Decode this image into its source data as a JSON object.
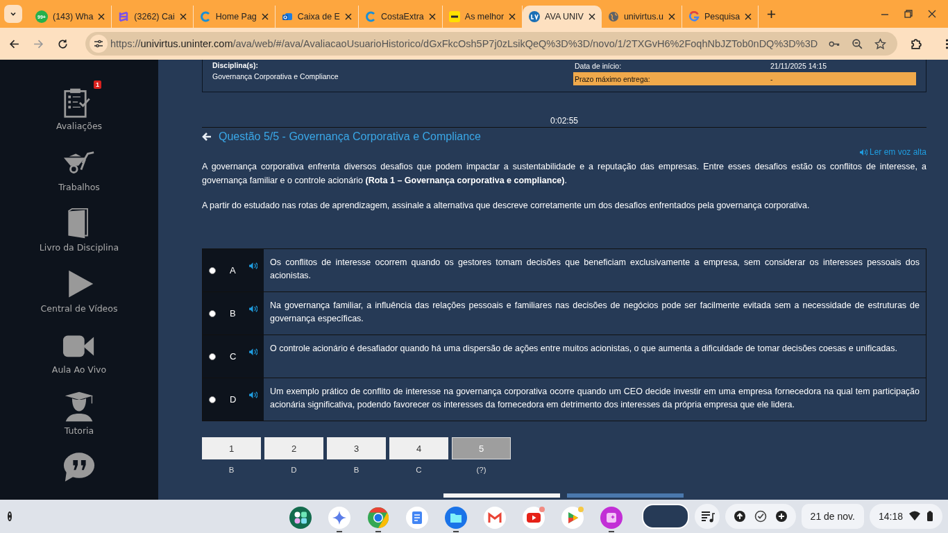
{
  "browser": {
    "tabs": [
      {
        "title": "(143) Wha",
        "badge": "99+",
        "selected": false
      },
      {
        "title": "(3262) Cai",
        "selected": false
      },
      {
        "title": "Home Pag",
        "selected": false
      },
      {
        "title": "Caixa de E",
        "selected": false
      },
      {
        "title": "CostaExtra",
        "selected": false
      },
      {
        "title": "As melhor",
        "selected": false
      },
      {
        "title": "AVA UNIV",
        "selected": true
      },
      {
        "title": "univirtus.u",
        "selected": false
      },
      {
        "title": "Pesquisa",
        "selected": false
      }
    ],
    "url_scheme": "https://",
    "url_host": "univirtus.uninter.com",
    "url_path": "/ava/web/#/ava/AvaliacaoUsuarioHistorico/dGxFkcOsh5P7j0zLsikQeQ%3D%3D/novo/1/2TXGvH6%2FoqhNbJZTob0nDQ%3D%3D"
  },
  "sidebar": {
    "items": [
      {
        "label": "Avaliações",
        "badge": "1"
      },
      {
        "label": "Trabalhos"
      },
      {
        "label": "Livro da Disciplina"
      },
      {
        "label": "Central de Vídeos"
      },
      {
        "label": "Aula Ao Vivo"
      },
      {
        "label": "Tutoria"
      }
    ]
  },
  "info": {
    "discipline_label": "Disciplina(s):",
    "discipline": "Governança Corporativa e Compliance",
    "start_label": "Data de início:",
    "start_value": "21/11/2025 14:15",
    "deadline_label": "Prazo máximo entrega:",
    "deadline_value": "-"
  },
  "timer": "0:02:55",
  "question": {
    "title": "Questão 5/5 - Governança Corporativa e Compliance",
    "read_aloud": "Ler em voz alta",
    "paragraphs": [
      "A governança corporativa enfrenta diversos desafios que podem impactar a sustentabilidade e a reputação das empresas. Entre esses desafios estão os conflitos de interesse, a governança familiar e o controle acionário **(Rota 1 – Governança corporativa e compliance)**.",
      "A partir do estudado nas rotas de aprendizagem, assinale a alternativa que descreve corretamente um dos desafios enfrentados pela governança corporativa."
    ],
    "options": [
      {
        "letter": "A",
        "text": "Os conflitos de interesse ocorrem quando os gestores tomam decisões que beneficiam exclusivamente a empresa, sem considerar os interesses pessoais dos acionistas.",
        "selected": false
      },
      {
        "letter": "B",
        "text": "Na governança familiar, a influência das relações pessoais e familiares nas decisões de negócios pode ser facilmente evitada sem a necessidade de estruturas de governança específicas.",
        "selected": false
      },
      {
        "letter": "C",
        "text": "O controle acionário é desafiador quando há uma dispersão de ações entre muitos acionistas, o que aumenta a dificuldade de tomar decisões coesas e unificadas.",
        "selected": false
      },
      {
        "letter": "D",
        "text": "Um exemplo prático de conflito de interesse na governança corporativa ocorre quando um CEO decide investir em uma empresa fornecedora na qual tem participação acionária significativa, podendo favorecer os interesses da fornecedora em detrimento dos interesses da própria empresa que ele lidera.",
        "selected": false
      }
    ]
  },
  "navigation": [
    {
      "number": "1",
      "answer": "B",
      "selected": false
    },
    {
      "number": "2",
      "answer": "D",
      "selected": false
    },
    {
      "number": "3",
      "answer": "B",
      "selected": false
    },
    {
      "number": "4",
      "answer": "C",
      "selected": false
    },
    {
      "number": "5",
      "answer": "(?)",
      "selected": true
    }
  ],
  "shelf": {
    "apps": [
      {
        "open": false
      },
      {
        "open": true
      },
      {
        "open": true
      },
      {
        "open": false
      },
      {
        "open": true
      },
      {
        "open": false
      },
      {
        "open": false
      },
      {
        "open": false
      },
      {
        "open": true
      }
    ],
    "date": "21 de nov.",
    "time": "14:18"
  }
}
